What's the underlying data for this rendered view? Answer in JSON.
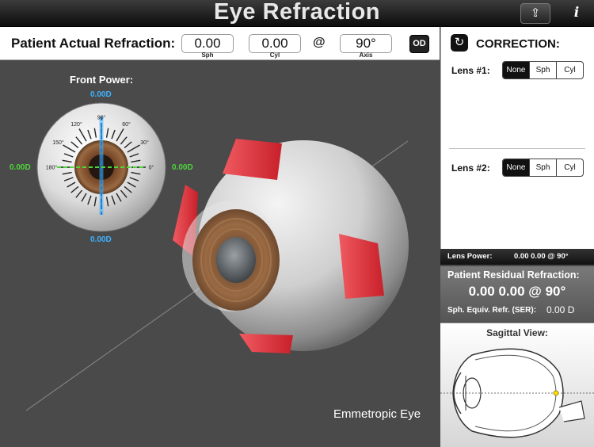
{
  "app": {
    "title": "Eye Refraction"
  },
  "patient_refraction": {
    "label": "Patient Actual Refraction:",
    "sph": "0.00",
    "sph_label": "Sph",
    "cyl": "0.00",
    "cyl_label": "Cyl",
    "at": "@",
    "axis": "90°",
    "axis_label": "Axis",
    "eye_button": "OD"
  },
  "front_power": {
    "title": "Front Power:",
    "top": "0.00D",
    "bottom": "0.00D",
    "left": "0.00D",
    "right": "0.00D",
    "angle_labels": [
      "90°",
      "60°",
      "30°",
      "0°",
      "180°",
      "150°",
      "120°"
    ]
  },
  "eye_label": "Emmetropic Eye",
  "correction": {
    "title": "CORRECTION:",
    "lens1": {
      "label": "Lens #1:",
      "options": [
        "None",
        "Sph",
        "Cyl"
      ],
      "selected": "None"
    },
    "lens2": {
      "label": "Lens #2:",
      "options": [
        "None",
        "Sph",
        "Cyl"
      ],
      "selected": "None"
    }
  },
  "lens_power": {
    "label": "Lens Power:",
    "value": "0.00 0.00 @ 90°"
  },
  "residual": {
    "title": "Patient Residual Refraction:",
    "value": "0.00 0.00 @ 90°",
    "ser_label": "Sph. Equiv. Refr. (SER):",
    "ser_value": "0.00 D"
  },
  "sagittal": {
    "title": "Sagittal View:"
  },
  "colors": {
    "power_vertical": "#3fb2ff",
    "power_horizontal": "#4ed63b",
    "muscle": "#e8333c"
  }
}
